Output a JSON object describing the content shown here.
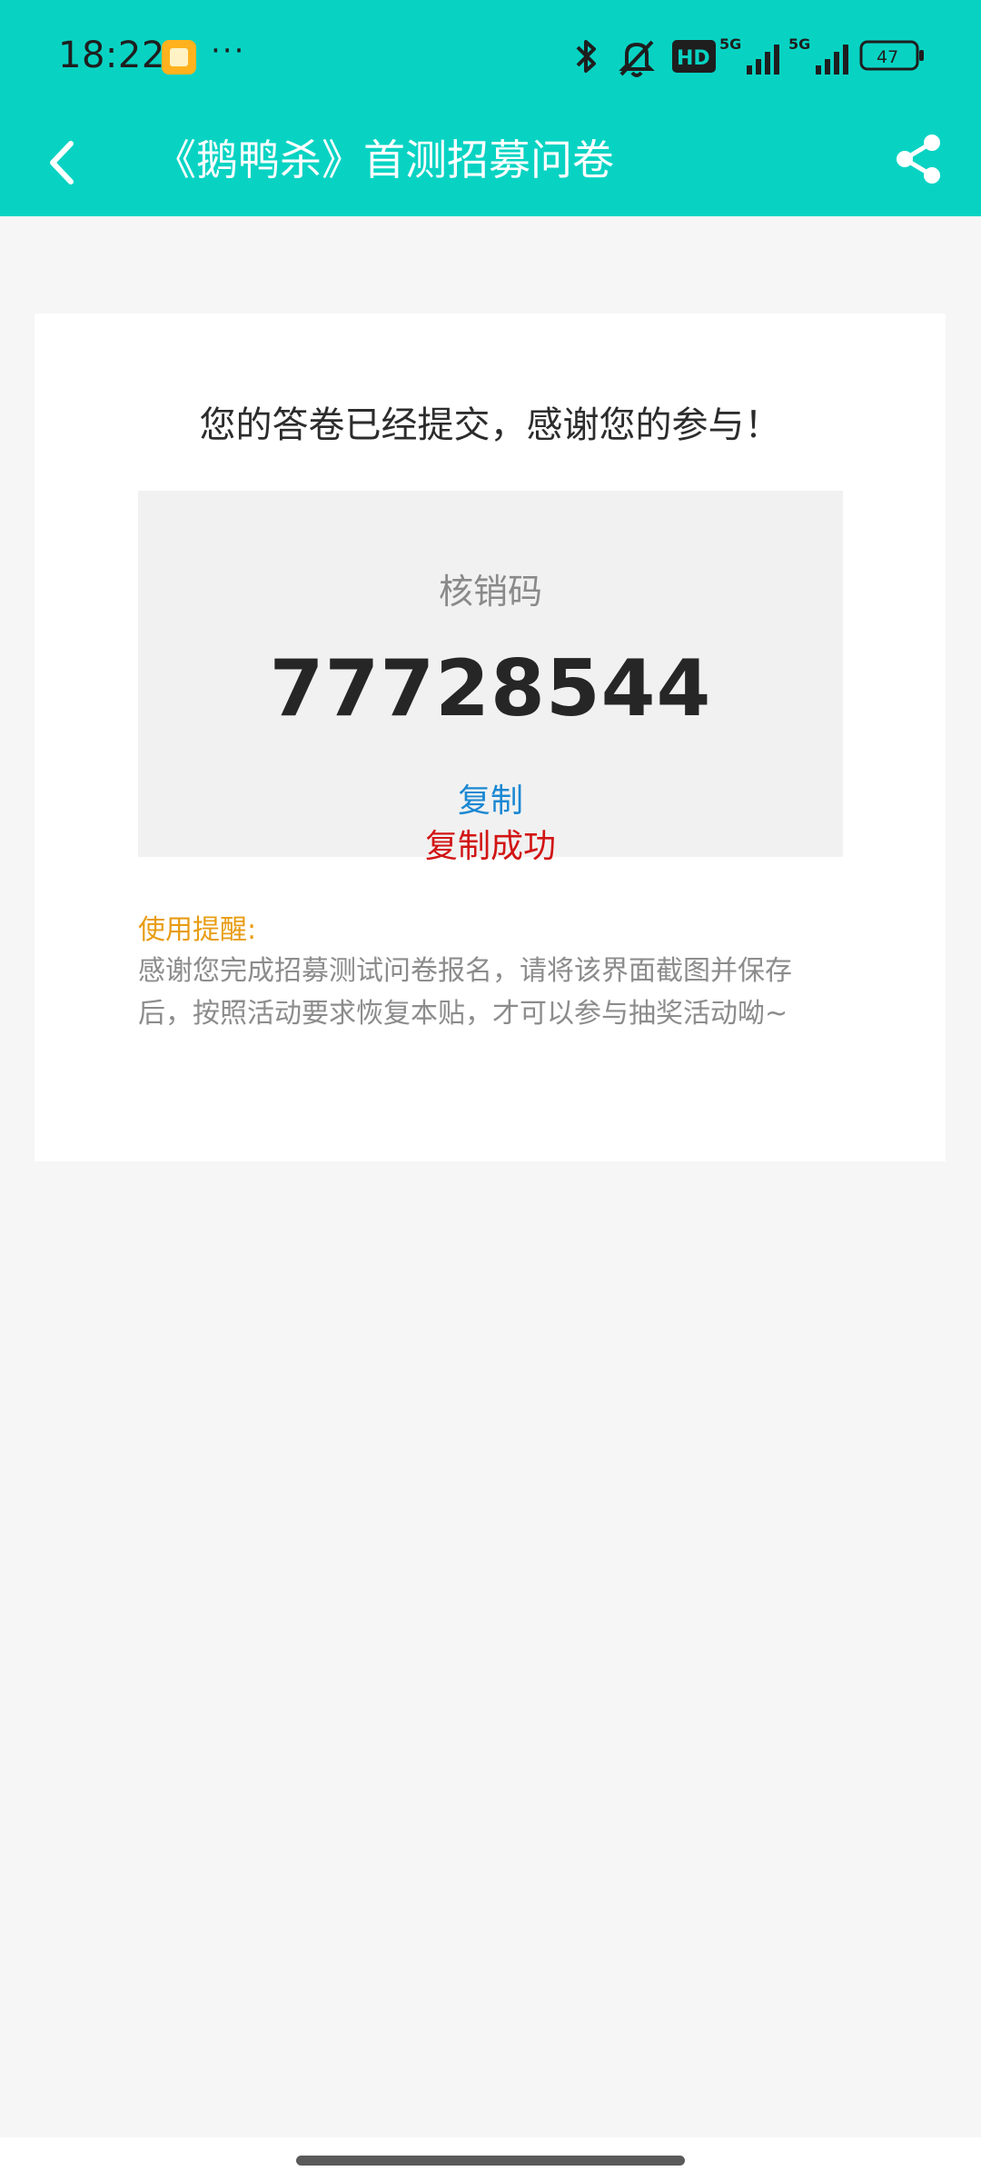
{
  "status_bar": {
    "time": "18:22",
    "more": "···",
    "battery": "47",
    "network_1": "5G",
    "network_2": "5G",
    "hd_label": "HD",
    "icons": [
      "notification-app-icon",
      "bluetooth-icon",
      "mute-icon",
      "hd-icon",
      "signal-icon",
      "signal-icon",
      "battery-icon"
    ]
  },
  "header": {
    "title": "《鹅鸭杀》首测招募问卷",
    "back_icon": "chevron-left-icon",
    "share_icon": "share-icon",
    "background_color": "#08d3c3"
  },
  "card": {
    "message": "您的答卷已经提交，感谢您的参与！",
    "code_label": "核销码",
    "code_value": "77728544",
    "copy_label": "复制",
    "copy_success": "复制成功",
    "tip_title": "使用提醒:",
    "tip_text": "感谢您完成招募测试问卷报名，请将该界面截图并保存后，按照活动要求恢复本贴，才可以参与抽奖活动呦~"
  },
  "colors": {
    "accent": "#08d3c3",
    "link": "#1b88d3",
    "success_text": "#d21414",
    "tip_title": "#e89c13"
  }
}
